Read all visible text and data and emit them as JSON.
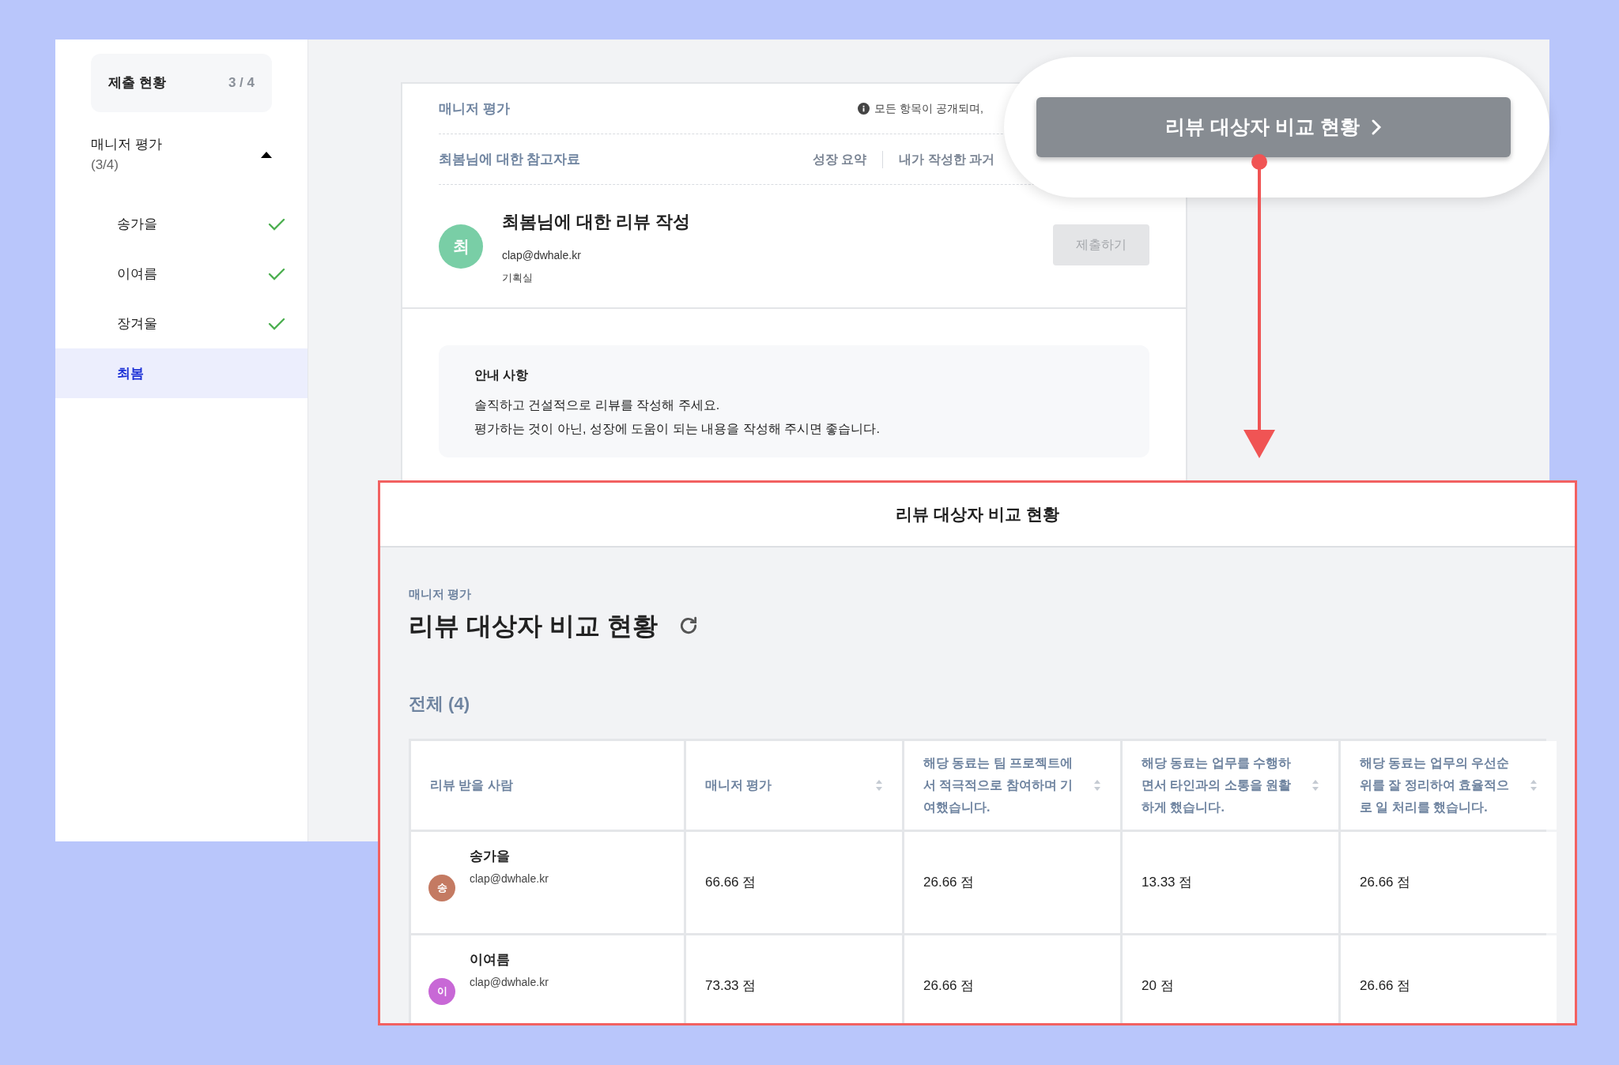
{
  "sidebar": {
    "summary": {
      "label": "제출 현황",
      "count": "3 / 4"
    },
    "group": {
      "title": "매니저 평가",
      "count": "(3/4)",
      "expanded": true
    },
    "items": [
      {
        "name": "송가을",
        "done": true,
        "selected": false
      },
      {
        "name": "이여름",
        "done": true,
        "selected": false
      },
      {
        "name": "장겨울",
        "done": true,
        "selected": false
      },
      {
        "name": "최봄",
        "done": false,
        "selected": true
      }
    ]
  },
  "review_card": {
    "section": "매니저 평가",
    "notice": "모든 항목이 공개되며,",
    "references_label": "최봄님에 대한 참고자료",
    "reference_links": [
      "성장 요약",
      "내가 작성한 과거"
    ],
    "avatar": "최",
    "title": "최봄님에 대한 리뷰 작성",
    "email": "clap@dwhale.kr",
    "department": "기획실",
    "submit_button": {
      "label": "제출하기",
      "disabled": true
    },
    "guide": {
      "title": "안내 사항",
      "lines": [
        "솔직하고 건설적으로 리뷰를 작성해 주세요.",
        "평가하는 것이 아닌, 성장에 도움이 되는 내용을 작성해 주시면 좋습니다."
      ]
    }
  },
  "callout_button": {
    "label": "리뷰 대상자 비교 현황"
  },
  "comparison": {
    "header": "리뷰 대상자 비교 현황",
    "subtitle": "매니저 평가",
    "title": "리뷰 대상자 비교 현황",
    "total": "전체 (4)",
    "table": {
      "columns": [
        {
          "label": "리뷰 받을 사람",
          "sortable": false
        },
        {
          "label": "매니저 평가",
          "sortable": true
        },
        {
          "label": "해당 동료는 팀 프로젝트에서 적극적으로 참여하며 기여했습니다.",
          "sortable": true
        },
        {
          "label": "해당 동료는 업무를 수행하면서 타인과의 소통을 원활하게 했습니다.",
          "sortable": true
        },
        {
          "label": "해당 동료는 업무의 우선순위를 잘 정리하여 효율적으로 일 처리를 했습니다.",
          "sortable": true
        }
      ],
      "rows": [
        {
          "avatar": "송",
          "color": "#c47a62",
          "name": "송가을",
          "email": "clap@dwhale.kr",
          "scores": [
            "66.66 점",
            "26.66 점",
            "13.33 점",
            "26.66 점"
          ]
        },
        {
          "avatar": "이",
          "color": "#c868d6",
          "name": "이여름",
          "email": "clap@dwhale.kr",
          "scores": [
            "73.33 점",
            "26.66 점",
            "20 점",
            "26.66 점"
          ]
        }
      ]
    }
  }
}
